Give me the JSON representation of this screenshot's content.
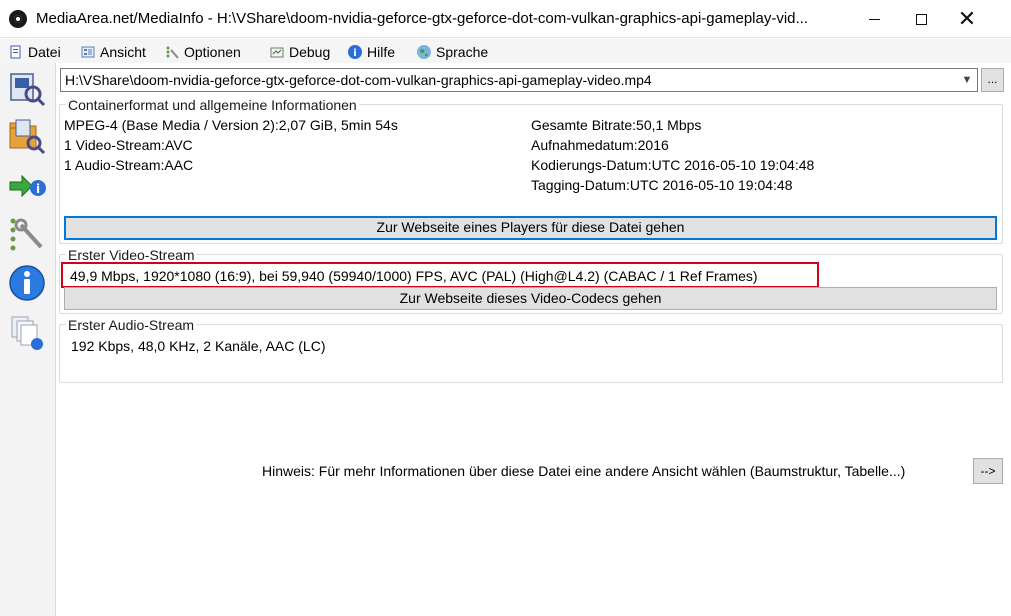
{
  "window": {
    "title": "MediaArea.net/MediaInfo - H:\\VShare\\doom-nvidia-geforce-gtx-geforce-dot-com-vulkan-graphics-api-gameplay-vid..."
  },
  "menu": {
    "items": [
      {
        "label": "Datei",
        "icon": "file-icon"
      },
      {
        "label": "Ansicht",
        "icon": "view-icon"
      },
      {
        "label": "Optionen",
        "icon": "options-icon"
      },
      {
        "label": "Debug",
        "icon": "debug-icon"
      },
      {
        "label": "Hilfe",
        "icon": "help-icon"
      },
      {
        "label": "Sprache",
        "icon": "globe-icon"
      }
    ]
  },
  "sidebar": {
    "icons": [
      "open-file-icon",
      "open-folder-icon",
      "export-icon",
      "preferences-icon",
      "about-icon",
      "knowledge-base-icon"
    ]
  },
  "file": {
    "path": "H:\\VShare\\doom-nvidia-geforce-gtx-geforce-dot-com-vulkan-graphics-api-gameplay-video.mp4",
    "browse_label": "..."
  },
  "container": {
    "title": "Containerformat und allgemeine Informationen",
    "left": [
      "MPEG-4 (Base Media / Version 2):2,07 GiB, 5min 54s",
      "1 Video-Stream:AVC",
      "1 Audio-Stream:AAC"
    ],
    "right": [
      "Gesamte Bitrate:50,1 Mbps",
      "Aufnahmedatum:2016",
      "Kodierungs-Datum:UTC 2016-05-10 19:04:48",
      "Tagging-Datum:UTC 2016-05-10 19:04:48"
    ],
    "button": "Zur Webseite eines Players für diese Datei gehen"
  },
  "video": {
    "title": "Erster Video-Stream",
    "info": "49,9 Mbps, 1920*1080 (16:9), bei 59,940 (59940/1000) FPS, AVC (PAL) (High@L4.2) (CABAC / 1 Ref Frames)",
    "button": "Zur Webseite dieses Video-Codecs gehen"
  },
  "audio": {
    "title": "Erster Audio-Stream",
    "info": "192 Kbps, 48,0 KHz, 2 Kanäle, AAC (LC)"
  },
  "hint": {
    "text": "Hinweis: Für mehr Informationen über diese Datei eine andere Ansicht wählen (Baumstruktur, Tabelle...)",
    "button": "-->"
  },
  "colors": {
    "highlight": "#d0021b",
    "focus": "#0078d7",
    "button_bg": "#e1e1e1"
  }
}
